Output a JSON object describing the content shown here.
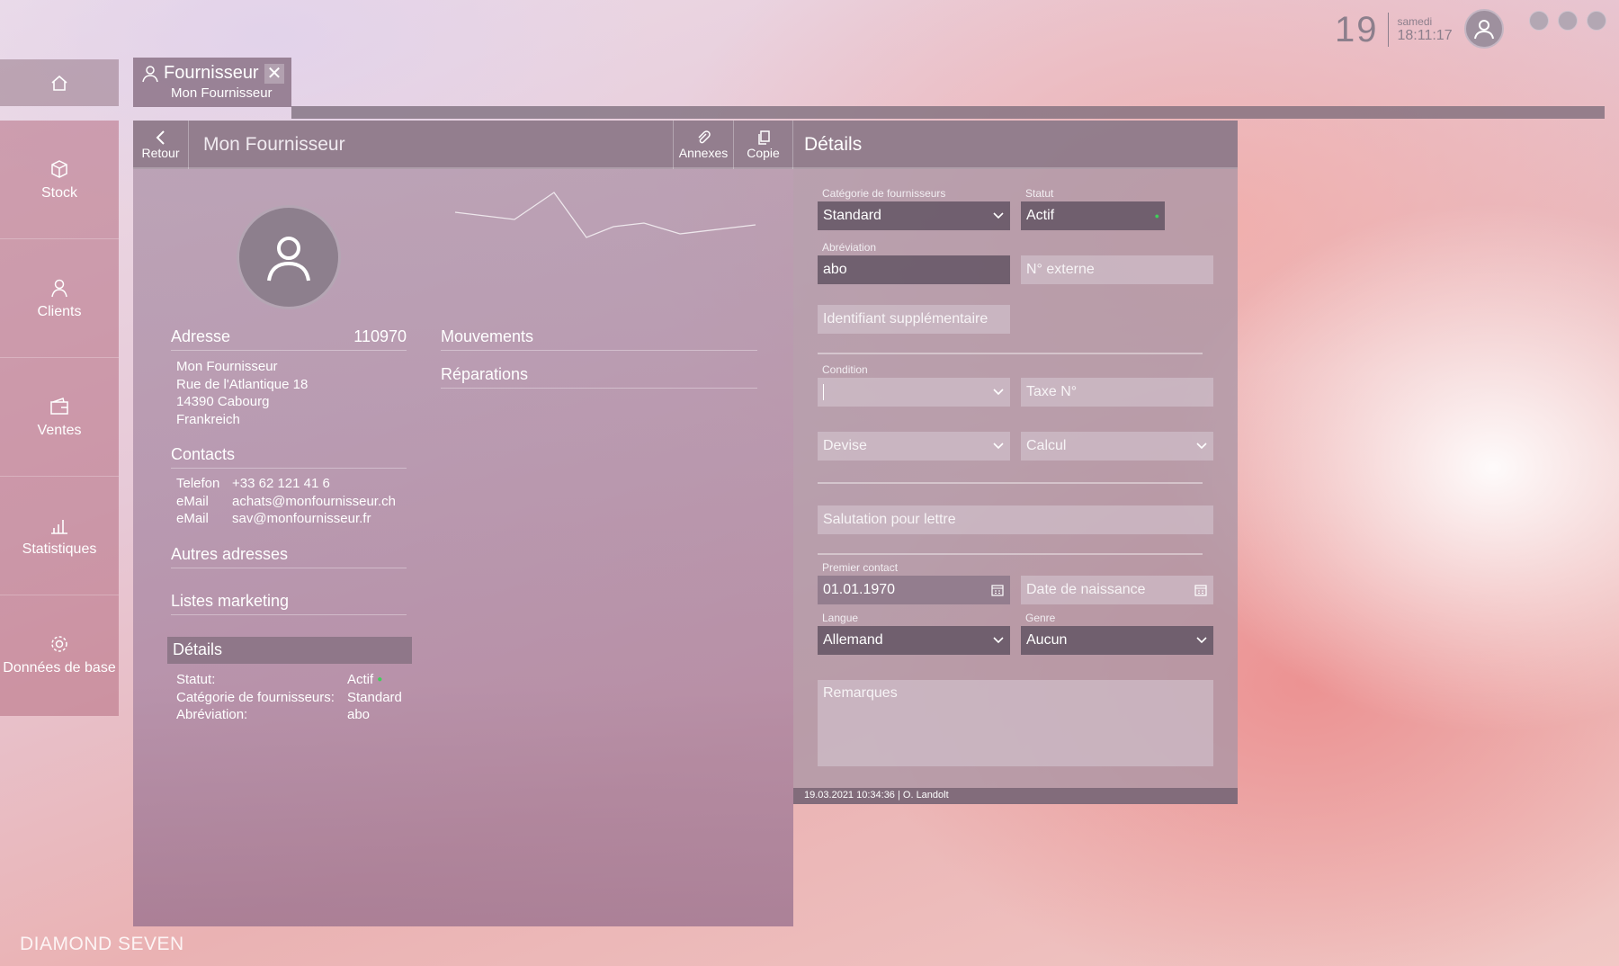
{
  "topbar": {
    "day": "19",
    "weekday": "samedi",
    "time": "18:11:17"
  },
  "sidebar": {
    "items": [
      {
        "label": "Stock",
        "icon": "box-icon"
      },
      {
        "label": "Clients",
        "icon": "person-icon"
      },
      {
        "label": "Ventes",
        "icon": "wallet-icon"
      },
      {
        "label": "Statistiques",
        "icon": "bar-chart-icon"
      },
      {
        "label": "Données de base",
        "icon": "gear-icon"
      }
    ]
  },
  "brand": "DIAMOND SEVEN",
  "tab": {
    "title": "Fournisseur",
    "subtitle": "Mon Fournisseur",
    "close": "✕"
  },
  "toolbar": {
    "back": "Retour",
    "title": "Mon Fournisseur",
    "annexes": "Annexes",
    "copie": "Copie"
  },
  "address": {
    "header": "Adresse",
    "number": "110970",
    "lines": [
      "Mon Fournisseur",
      "Rue de l'Atlantique 18",
      "14390 Cabourg",
      "Frankreich"
    ]
  },
  "contacts": {
    "header": "Contacts",
    "items": [
      {
        "type": "Telefon",
        "value": "+33 62 121 41 6"
      },
      {
        "type": "eMail",
        "value": "achats@monfournisseur.ch"
      },
      {
        "type": "eMail",
        "value": "sav@monfournisseur.fr"
      }
    ]
  },
  "sections": {
    "autres": "Autres adresses",
    "listes": "Listes marketing",
    "mouvements": "Mouvements",
    "reparations": "Réparations"
  },
  "details_summary": {
    "header": "Détails",
    "rows": [
      {
        "k": "Statut:",
        "v": "Actif"
      },
      {
        "k": "Catégorie de fournisseurs:",
        "v": "Standard"
      },
      {
        "k": "Abréviation:",
        "v": "abo"
      }
    ]
  },
  "details": {
    "title": "Détails",
    "categorie_label": "Catégorie de fournisseurs",
    "categorie": "Standard",
    "statut_label": "Statut",
    "statut": "Actif",
    "abreviation_label": "Abréviation",
    "abreviation": "abo",
    "n_externe_placeholder": "N° externe",
    "identifiant_placeholder": "Identifiant supplémentaire",
    "condition_label": "Condition",
    "condition": "",
    "taxe_placeholder": "Taxe N°",
    "devise_placeholder": "Devise",
    "calcul_placeholder": "Calcul",
    "salutation_placeholder": "Salutation pour lettre",
    "premier_contact_label": "Premier contact",
    "premier_contact": "01.01.1970",
    "date_naissance_placeholder": "Date de naissance",
    "langue_label": "Langue",
    "langue": "Allemand",
    "genre_label": "Genre",
    "genre": "Aucun",
    "remarques_placeholder": "Remarques",
    "footer": "19.03.2021 10:34:36 | O. Landolt"
  },
  "colors": {
    "status_active": "#3fcf5a"
  }
}
